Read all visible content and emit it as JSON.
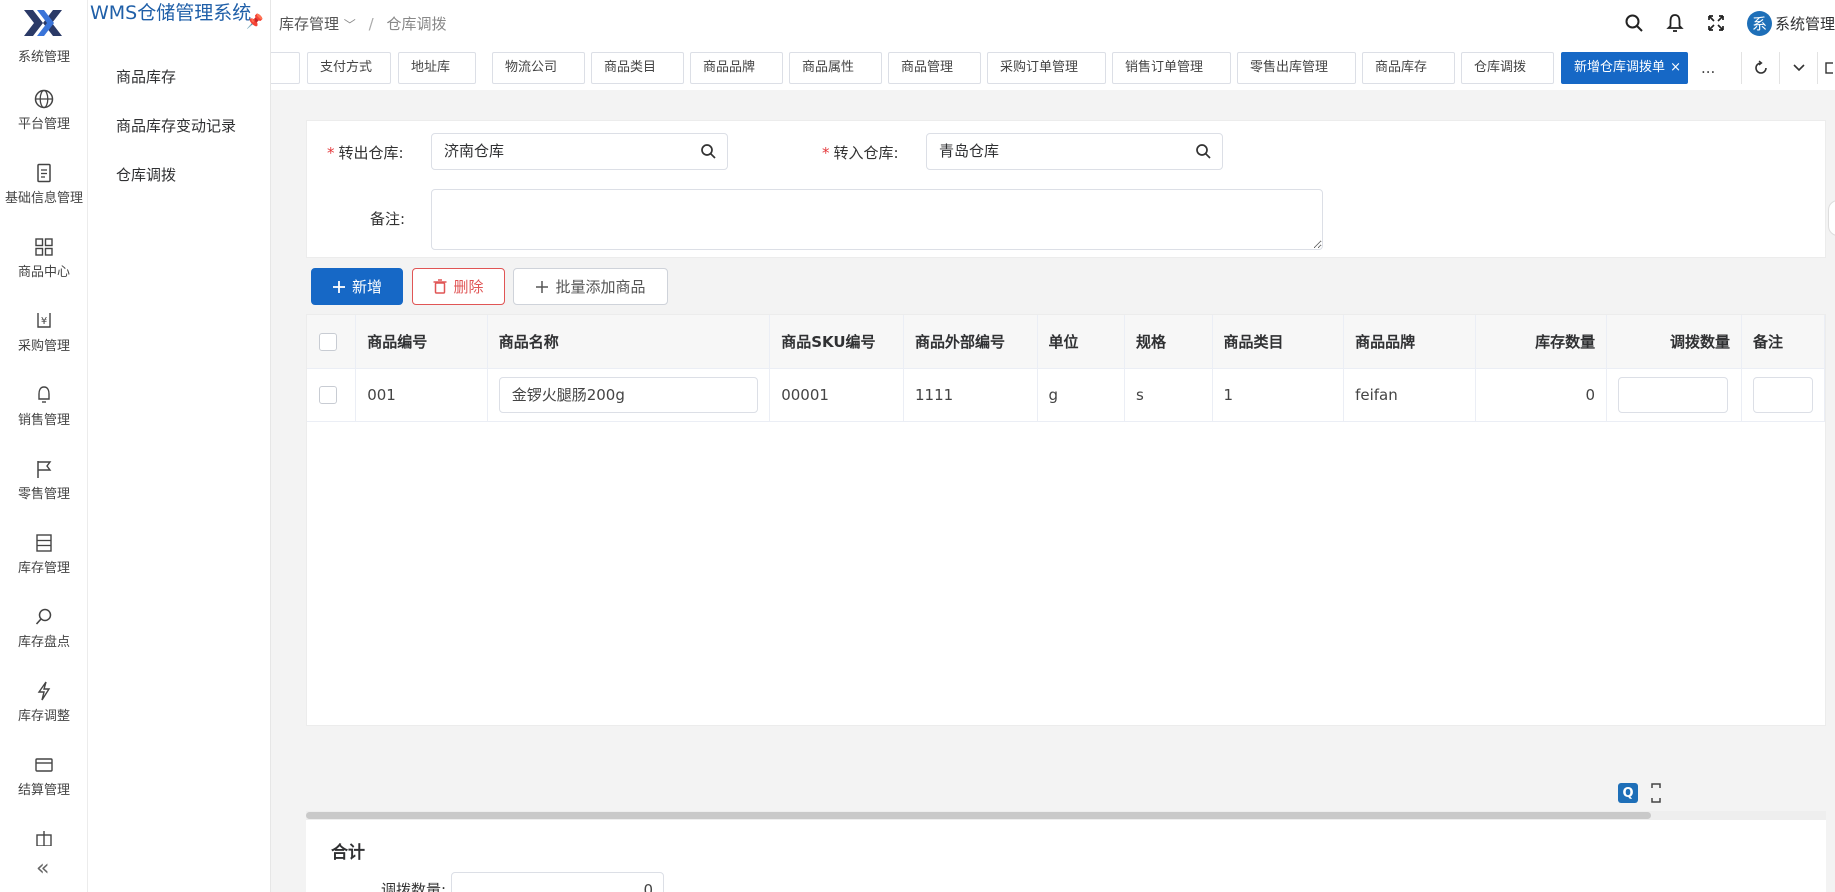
{
  "app": {
    "title": "WMS仓储管理系统"
  },
  "rail": {
    "items": [
      {
        "label": "系统管理",
        "icon": "system-icon"
      },
      {
        "label": "平台管理",
        "icon": "globe-icon"
      },
      {
        "label": "基础信息管理",
        "icon": "document-icon"
      },
      {
        "label": "商品中心",
        "icon": "grid-icon"
      },
      {
        "label": "采购管理",
        "icon": "yen-icon"
      },
      {
        "label": "销售管理",
        "icon": "bell-tag-icon"
      },
      {
        "label": "零售管理",
        "icon": "flag-icon"
      },
      {
        "label": "库存管理",
        "icon": "inventory-icon"
      },
      {
        "label": "库存盘点",
        "icon": "search-count-icon"
      },
      {
        "label": "库存调整",
        "icon": "lightning-icon"
      },
      {
        "label": "结算管理",
        "icon": "card-icon"
      }
    ],
    "collapse": "«"
  },
  "submenu": {
    "items": [
      "商品库存",
      "商品库存变动记录",
      "仓库调拨"
    ]
  },
  "breadcrumb": {
    "parent": "库存管理",
    "sep": "/",
    "current": "仓库调拨"
  },
  "user": {
    "avatar": "系",
    "name": "系统管理"
  },
  "tabs": [
    {
      "label": "支付方式"
    },
    {
      "label": "地址库"
    },
    {
      "label": "物流公司"
    },
    {
      "label": "商品类目"
    },
    {
      "label": "商品品牌"
    },
    {
      "label": "商品属性"
    },
    {
      "label": "商品管理"
    },
    {
      "label": "采购订单管理"
    },
    {
      "label": "销售订单管理"
    },
    {
      "label": "零售出库管理"
    },
    {
      "label": "商品库存"
    },
    {
      "label": "仓库调拨"
    },
    {
      "label": "新增仓库调拨单"
    }
  ],
  "tabs_more": "...",
  "form": {
    "out_label": "转出仓库:",
    "out_value": "济南仓库",
    "in_label": "转入仓库:",
    "in_value": "青岛仓库",
    "note_label": "备注:",
    "required_mark": "*"
  },
  "toolbar": {
    "add": "新增",
    "delete": "删除",
    "batch_add": "批量添加商品"
  },
  "table": {
    "headers": [
      "商品编号",
      "商品名称",
      "商品SKU编号",
      "商品外部编号",
      "单位",
      "规格",
      "商品类目",
      "商品品牌",
      "库存数量",
      "调拨数量",
      "备注"
    ],
    "rows": [
      {
        "code": "001",
        "name": "金锣火腿肠200g",
        "sku": "00001",
        "external": "1111",
        "unit": "g",
        "spec": "s",
        "category": "1",
        "brand": "feifan",
        "stock": "0",
        "qty": "",
        "note": ""
      }
    ]
  },
  "total": {
    "title": "合计",
    "label": "调拨数量:",
    "value": "0"
  },
  "float": {
    "q": "Q"
  }
}
